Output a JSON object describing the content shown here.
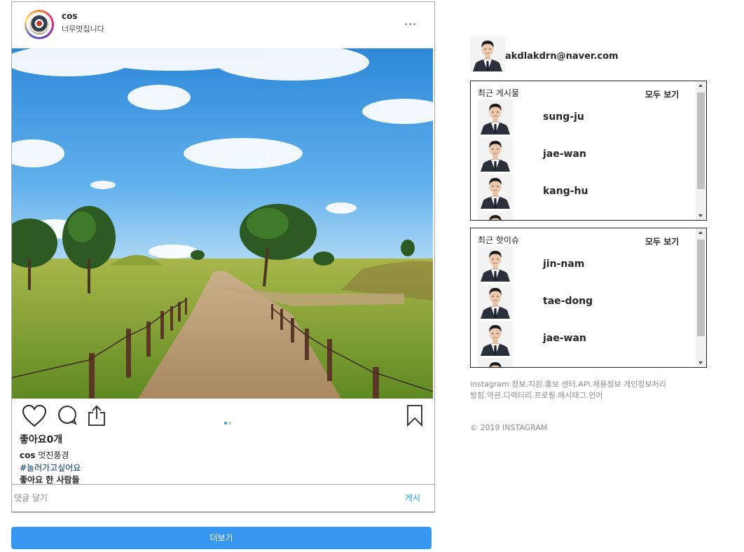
{
  "post": {
    "username": "cos",
    "subtitle": "너무멋집니다",
    "more_icon": "ellipsis-icon",
    "likes": "좋아요0개",
    "caption_user": "cos",
    "caption_text": " 멋진풍경",
    "hashtag": "#놀러가고싶어요",
    "liked_by": "좋아요 한 사람들",
    "comment_placeholder": "댓글 달기",
    "post_button": "게시",
    "carousel": {
      "count": 2,
      "active": 0
    },
    "colors": {
      "accent": "#3897f0",
      "dot_active": "#3897f0",
      "dot_inactive": "#c7c7c7"
    }
  },
  "more_button": "더보기",
  "sidebar": {
    "email": "akdlakdrn@naver.com",
    "recent_posts": {
      "title": "최근 게시물",
      "view_all": "모두 보기",
      "items": [
        {
          "name": "sung-ju"
        },
        {
          "name": "jae-wan"
        },
        {
          "name": "kang-hu"
        }
      ]
    },
    "hot_issues": {
      "title": "최근 핫이슈",
      "view_all": "모두 보기",
      "items": [
        {
          "name": "jin-nam"
        },
        {
          "name": "tae-dong"
        },
        {
          "name": "jae-wan"
        }
      ]
    },
    "footer_links": "instagram 정보.지원.홍보 센터.API.채용정보 개인정보처리방침.약관.디렉터리.프로필.해시태그.언어",
    "copyright": "© 2019 INSTAGRAM"
  }
}
